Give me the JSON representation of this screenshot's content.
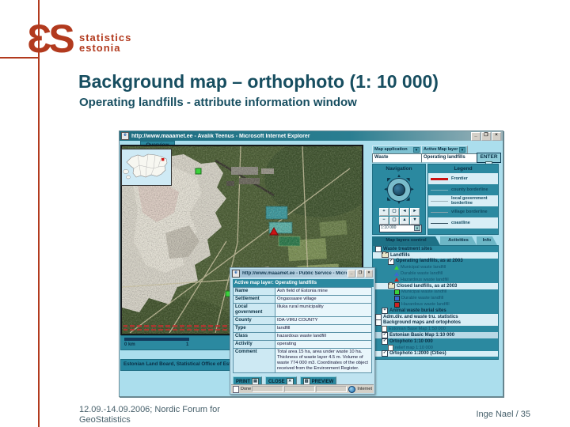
{
  "slide": {
    "logo": {
      "glyphs": "ƐS",
      "line1": "statistics",
      "line2": "estonia",
      "brand_color": "#b23a1e"
    },
    "title": "Background map – orthophoto (1: 10 000)",
    "subtitle": "Operating landfills - attribute information window",
    "footer_left_line1": "12.09.-14.09.2006; Nordic Forum for",
    "footer_left_line2": "GeoStatistics",
    "footer_right": "Inge Nael / 35",
    "title_color": "#174e60"
  },
  "icons": {
    "dropdown_arrow": "▼",
    "enter_arrow": "→",
    "minimize": "_",
    "maximize": "❐",
    "close": "×"
  },
  "browser": {
    "title": "http://www.maaamet.ee - Avalik Teenus - Microsoft Internet Explorer",
    "overview_tab": "Overview",
    "toolbar": {
      "map_application_label": "Map application",
      "map_application_value": "Waste",
      "active_layer_label": "Active Map layer",
      "active_layer_value": "Operating landfills",
      "enter_label": "ENTER"
    },
    "navigation": {
      "title": "Navigation",
      "tools": [
        {
          "name": "zoom-in-tool",
          "glyph": "+"
        },
        {
          "name": "pan-tool",
          "glyph": "▢"
        },
        {
          "name": "move-left-tool",
          "glyph": "◄"
        },
        {
          "name": "move-right-tool",
          "glyph": "►"
        },
        {
          "name": "zoom-out-tool",
          "glyph": "−"
        },
        {
          "name": "full-extent-tool",
          "glyph": "▢"
        },
        {
          "name": "move-up-tool",
          "glyph": "▲"
        },
        {
          "name": "move-down-tool",
          "glyph": "▼"
        }
      ],
      "scale_value": "1:10 000"
    },
    "legend": {
      "title": "Legend",
      "items": [
        {
          "label": "Frontier",
          "color": "#cc1111",
          "weight": 3
        },
        {
          "label": "county borderline",
          "color": "#7fb3c0",
          "weight": 1
        },
        {
          "label": "local government borderline",
          "color": "#9ab0b8",
          "weight": 1
        },
        {
          "label": "village borderline",
          "color": "#8aa4ae",
          "weight": 1
        },
        {
          "label": "coastline",
          "color": "#2d4a5a",
          "weight": 1
        }
      ]
    },
    "tabs": [
      {
        "label": "Map layers control",
        "active": true
      },
      {
        "label": "Activities",
        "active": false
      },
      {
        "label": "Info",
        "active": false
      }
    ],
    "layers_tree": [
      {
        "label": "Waste treatment sites",
        "icon": "checkbox",
        "checked": false,
        "indent": 0,
        "bold": true,
        "bg": "teal"
      },
      {
        "label": "Landfills",
        "icon": "folder",
        "indent": 1,
        "bold": true,
        "bg": "light"
      },
      {
        "label": "Operating landfills, as at 2003",
        "icon": "checkbox",
        "checked": true,
        "indent": 2,
        "bold": true,
        "bg": "teal"
      },
      {
        "label": "Municipal waste landfill",
        "icon": "tri",
        "color": "#3ad23a",
        "indent": 3,
        "bold": false,
        "bg": "teal"
      },
      {
        "label": "Durable waste landfill",
        "icon": "tri",
        "color": "#3a6ad2",
        "indent": 3,
        "bold": false,
        "bg": "teal"
      },
      {
        "label": "Hazardous waste landfill",
        "icon": "tri",
        "color": "#cc2222",
        "indent": 3,
        "bold": false,
        "bg": "teal"
      },
      {
        "label": "Closed landfills, as at 2003",
        "icon": "folder",
        "indent": 2,
        "bold": true,
        "bg": "light"
      },
      {
        "label": "Municipal waste landfill",
        "icon": "sq",
        "color": "#3ad23a",
        "indent": 3,
        "bold": false,
        "bg": "teal"
      },
      {
        "label": "Durable waste landfill",
        "icon": "sq",
        "color": "#3a6ad2",
        "indent": 3,
        "bold": false,
        "bg": "teal"
      },
      {
        "label": "Hazardous waste landfill",
        "icon": "sq",
        "color": "#cc2222",
        "indent": 3,
        "bold": false,
        "bg": "teal"
      },
      {
        "label": "Animal waste burial sites",
        "icon": "checkbox-plus",
        "checked": false,
        "indent": 1,
        "bold": true,
        "bg": "teal"
      },
      {
        "label": "Adm.div. and waste tru. statistics",
        "icon": "checkbox",
        "checked": false,
        "indent": 0,
        "bold": true,
        "bg": "light"
      },
      {
        "label": "Background maps and ortophotos",
        "icon": "checkbox",
        "checked": false,
        "indent": 0,
        "bold": true,
        "bg": "light"
      },
      {
        "label": "Estonian Base Map 1:50 000",
        "icon": "doc",
        "indent": 1,
        "bold": false,
        "bg": "teal"
      },
      {
        "label": "Estonian Basic Map 1:10 000",
        "icon": "checkbox",
        "checked": true,
        "indent": 1,
        "bold": true,
        "bg": "selected"
      },
      {
        "label": "Ortophoto 1:10 000",
        "icon": "checkbox",
        "checked": true,
        "indent": 1,
        "bold": true,
        "bg": "teal"
      },
      {
        "label": "relief map 1:10 000",
        "icon": "doc",
        "indent": 2,
        "bold": false,
        "bg": "teal"
      },
      {
        "label": "Ortophoto 1:2000 (Cities)",
        "icon": "checkbox",
        "checked": true,
        "indent": 1,
        "bold": true,
        "bg": "light"
      }
    ],
    "scalebar": {
      "zero_label": "0 km",
      "one_label": "1"
    },
    "credit": "Estonian Land Board, Statistical Office of Estonia"
  },
  "popup": {
    "title": "http://www.maaamet.ee - Public Service - Microsoft Internet Explorer",
    "header": "Active map layer: Operating landfills",
    "rows": [
      {
        "label": "Name",
        "value": "Ash field of Estonia mine"
      },
      {
        "label": "Settlement",
        "value": "Ongassaare village"
      },
      {
        "label": "Local government",
        "value": "Illuka rural municipality"
      },
      {
        "label": "County",
        "value": "IDA-VIRU COUNTY"
      },
      {
        "label": "Type",
        "value": "landfill"
      },
      {
        "label": "Class",
        "value": "hazardous waste landfill"
      },
      {
        "label": "Activity",
        "value": "operating"
      },
      {
        "label": "Comment",
        "value": "Total area 15 ha, area under waste 10 ha. Thickness of waste layer 4.5 m. Volume of waste 774 000 m3. Coordinates of the object received from the Environment Register."
      }
    ],
    "buttons": [
      "PRINT",
      "CLOSE",
      "PREVIEW"
    ],
    "status_left": "Done",
    "status_right": "Internet"
  }
}
